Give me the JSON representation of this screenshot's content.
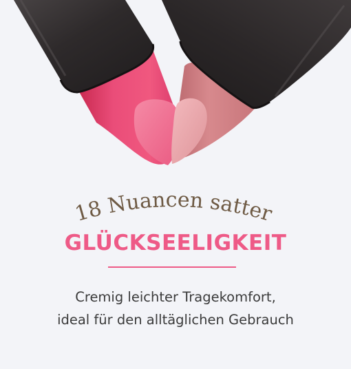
{
  "banner": {
    "tagline": "18 Nuancen satter",
    "headline": "GLÜCKSEELIGKEIT",
    "description_line1": "Cremig leichter Tragekomfort,",
    "description_line2": "ideal für den alltäglichen Gebrauch"
  },
  "colors": {
    "background": "#f3f4f8",
    "accent": "#ee5a87",
    "tagline": "#6e5a44",
    "body_text": "#3a3a3a",
    "case": "#2f2c2c",
    "lipstick_left": "#e23a6a",
    "lipstick_right": "#c8797e"
  }
}
